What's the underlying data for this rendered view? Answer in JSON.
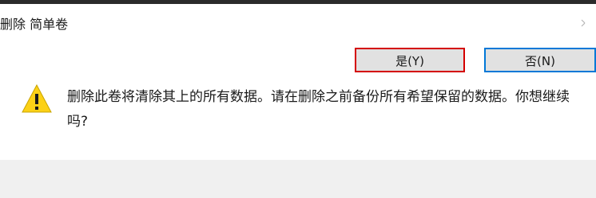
{
  "dialog": {
    "title": "删除 简单卷",
    "message": "删除此卷将清除其上的所有数据。请在删除之前备份所有希望保留的数据。你想继续吗?",
    "icons": {
      "warning": "warning-icon",
      "close": "close-icon"
    },
    "buttons": {
      "yes_label": "是(Y)",
      "no_label": "否(N)"
    },
    "colors": {
      "highlight_border": "#d40000",
      "default_button_border": "#0078d7",
      "warning_fill": "#fcd116"
    }
  }
}
